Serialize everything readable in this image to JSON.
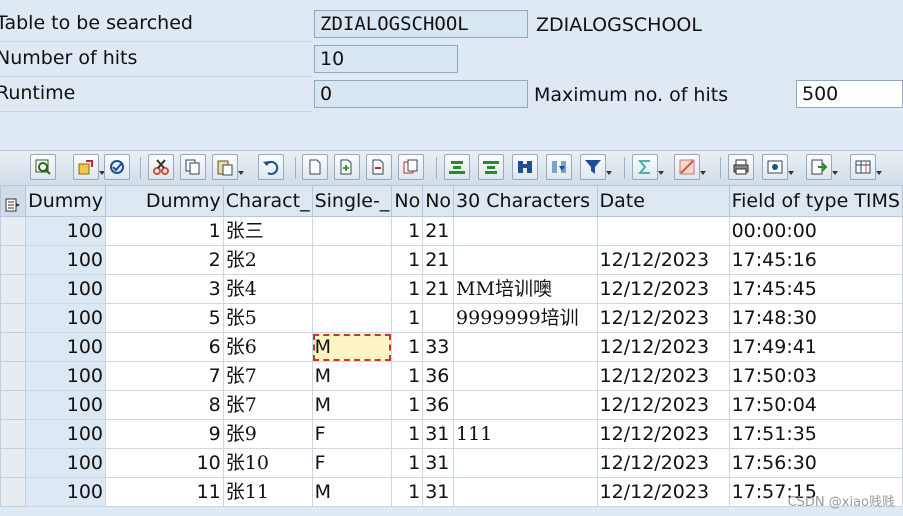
{
  "form": {
    "table_label": "Table to be searched",
    "table_value": "ZDIALOGSCHOOL",
    "table_desc": "ZDIALOGSCHOOL",
    "hits_label": "Number of hits",
    "hits_value": "10",
    "runtime_label": "Runtime",
    "runtime_value": "0",
    "max_hits_label": "Maximum no. of hits",
    "max_hits_value": "500"
  },
  "toolbar": {
    "buttons": [
      "details-icon",
      "refresh-icon",
      "check-icon",
      "cut-icon",
      "copy-icon",
      "paste-icon",
      "undo-icon",
      "new-row-icon",
      "insert-row-icon",
      "delete-row-icon",
      "duplicate-row-icon",
      "sort-asc-icon",
      "sort-desc-icon",
      "find-icon",
      "find-next-icon",
      "filter-icon",
      "sum-icon",
      "subtotal-icon",
      "print-icon",
      "views-icon",
      "export-icon",
      "layout-icon"
    ]
  },
  "grid": {
    "columns": [
      "Dummy",
      "Dummy",
      "Charact_",
      "Single-_",
      "No",
      "No",
      "30 Characters",
      "Date",
      "Field of type TIMS"
    ],
    "rows": [
      [
        "100",
        "1",
        "张三",
        "",
        "1",
        "21",
        "",
        "",
        "00:00:00"
      ],
      [
        "100",
        "2",
        "张2",
        "",
        "1",
        "21",
        "",
        "12/12/2023",
        "17:45:16"
      ],
      [
        "100",
        "3",
        "张4",
        "",
        "1",
        "21",
        "MM培训噢",
        "12/12/2023",
        "17:45:45"
      ],
      [
        "100",
        "5",
        "张5",
        "",
        "1",
        "",
        "9999999培训",
        "12/12/2023",
        "17:48:30"
      ],
      [
        "100",
        "6",
        "张6",
        "M",
        "1",
        "33",
        "",
        "12/12/2023",
        "17:49:41"
      ],
      [
        "100",
        "7",
        "张7",
        "M",
        "1",
        "36",
        "",
        "12/12/2023",
        "17:50:03"
      ],
      [
        "100",
        "8",
        "张7",
        "M",
        "1",
        "36",
        "",
        "12/12/2023",
        "17:50:04"
      ],
      [
        "100",
        "9",
        "张9",
        "F",
        "1",
        "31",
        "111",
        "12/12/2023",
        "17:51:35"
      ],
      [
        "100",
        "10",
        "张10",
        "F",
        "1",
        "31",
        "",
        "12/12/2023",
        "17:56:30"
      ],
      [
        "100",
        "11",
        "张11",
        "M",
        "1",
        "31",
        "",
        "12/12/2023",
        "17:57:15"
      ]
    ]
  },
  "watermark": "CSDN @xiao贱贱",
  "colors": {
    "header_bg": "#dce7f1",
    "key_col_bg": "#dbe7f3",
    "edit_cell_bg": "#fdf3c4",
    "edit_outline": "#c8372d"
  }
}
